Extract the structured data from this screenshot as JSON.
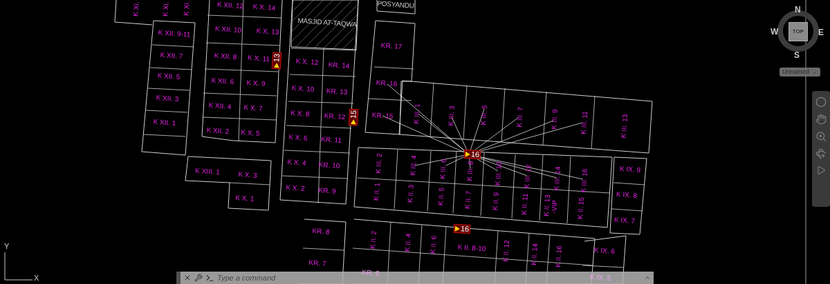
{
  "plots": [
    {
      "label": "K XI."
    },
    {
      "label": "K XI."
    },
    {
      "label": "K XI."
    },
    {
      "label": "K XII. 12"
    },
    {
      "label": "K X. 14"
    },
    {
      "label": "K XII. 10"
    },
    {
      "label": "K X. 13"
    },
    {
      "label": "K XII. 9-11"
    },
    {
      "label": "K XII. 7"
    },
    {
      "label": "K XII. 8"
    },
    {
      "label": "K X. 11"
    },
    {
      "label": "K XII. 5"
    },
    {
      "label": "K XII. 6"
    },
    {
      "label": "K X. 9"
    },
    {
      "label": "K XII. 3"
    },
    {
      "label": "K XII. 4"
    },
    {
      "label": "K X. 7"
    },
    {
      "label": "K XII. 1"
    },
    {
      "label": "K XII. 2"
    },
    {
      "label": "K X. 5"
    },
    {
      "label": "K XIII. 1"
    },
    {
      "label": "K X. 3"
    },
    {
      "label": "K X. 1"
    },
    {
      "label": "K X. 12"
    },
    {
      "label": "KR. 14"
    },
    {
      "label": "K X. 10"
    },
    {
      "label": "KR. 13"
    },
    {
      "label": "K X. 8"
    },
    {
      "label": "KR. 12"
    },
    {
      "label": "K X. 6"
    },
    {
      "label": "KR. 11"
    },
    {
      "label": "K X. 4"
    },
    {
      "label": "KR. 10"
    },
    {
      "label": "K X. 2"
    },
    {
      "label": "KR. 9"
    },
    {
      "label": "KR. 17"
    },
    {
      "label": "KR. 16"
    },
    {
      "label": "KR. 15"
    },
    {
      "label": "KR. 8"
    },
    {
      "label": "KR. 7"
    },
    {
      "label": "K III. 1"
    },
    {
      "label": "K III. 3"
    },
    {
      "label": "K III. 5"
    },
    {
      "label": "K III. 7"
    },
    {
      "label": "K III. 9"
    },
    {
      "label": "K III. 11"
    },
    {
      "label": "K III. 13"
    },
    {
      "label": "K III. 2"
    },
    {
      "label": "K III. 4"
    },
    {
      "label": "K III. 6"
    },
    {
      "label": "K III. 8"
    },
    {
      "label": "K III. 10"
    },
    {
      "label": "K III. 12"
    },
    {
      "label": "K III. 14"
    },
    {
      "label": "K III. 16"
    },
    {
      "label": "K II. 1"
    },
    {
      "label": "K II. 3"
    },
    {
      "label": "K II. 5"
    },
    {
      "label": "K II. 7"
    },
    {
      "label": "K II. 9"
    },
    {
      "label": "K II. 11"
    },
    {
      "label": "K II. 13"
    },
    {
      "label": "-VIP"
    },
    {
      "label": "K II. 15"
    },
    {
      "label": "K IX. 9"
    },
    {
      "label": "K IX. 8"
    },
    {
      "label": "K IX. 7"
    },
    {
      "label": "K IX. 6"
    },
    {
      "label": "K II. 2"
    },
    {
      "label": "K II. 4"
    },
    {
      "label": "K II. 6"
    },
    {
      "label": "K II. 8-10"
    },
    {
      "label": "K II. 12"
    },
    {
      "label": "K II. 14"
    },
    {
      "label": "K II. 16"
    },
    {
      "label": "KR. 6"
    },
    {
      "label": "K IX. 5"
    }
  ],
  "buildings": [
    {
      "label": "MASJID AT-TAQWA"
    },
    {
      "label": "POSYANDU"
    }
  ],
  "markers": [
    {
      "label": "13"
    },
    {
      "label": "15"
    },
    {
      "label": "16"
    },
    {
      "label": "16"
    }
  ],
  "viewcube": {
    "north": "N",
    "west": "W",
    "east": "E",
    "south": "S",
    "face": "TOP"
  },
  "view_menu": {
    "label": "Unnamed"
  },
  "axes": {
    "y": "Y",
    "x": "X"
  },
  "command_line": {
    "placeholder": "Type a command"
  }
}
